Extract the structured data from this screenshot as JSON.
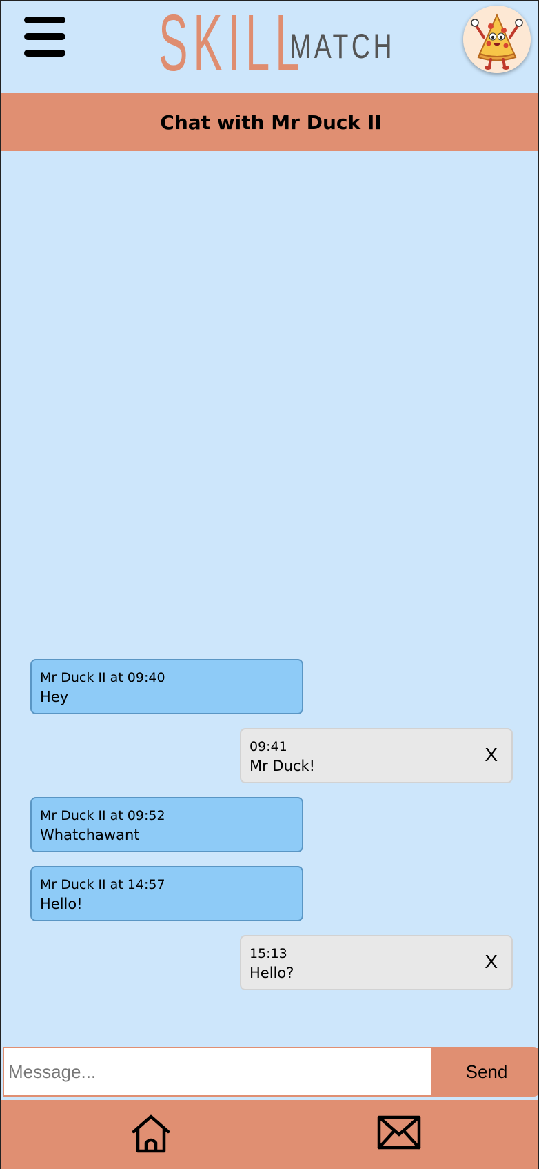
{
  "header": {
    "logo_primary": "SKILL",
    "logo_secondary": "MATCH",
    "menu_icon": "hamburger-menu-icon",
    "avatar_icon": "pizza-character-avatar"
  },
  "chat": {
    "title": "Chat with Mr Duck II",
    "messages": [
      {
        "direction": "incoming",
        "meta": "Mr Duck II at 09:40",
        "text": "Hey"
      },
      {
        "direction": "outgoing",
        "meta": "09:41",
        "text": "Mr Duck!",
        "delete_label": "X"
      },
      {
        "direction": "incoming",
        "meta": "Mr Duck II at 09:52",
        "text": "Whatchawant"
      },
      {
        "direction": "incoming",
        "meta": "Mr Duck II at 14:57",
        "text": "Hello!"
      },
      {
        "direction": "outgoing",
        "meta": "15:13",
        "text": "Hello?",
        "delete_label": "X"
      }
    ]
  },
  "composer": {
    "placeholder": "Message...",
    "value": "",
    "send_label": "Send"
  },
  "bottom_nav": {
    "home_icon": "home-icon",
    "messages_icon": "mail-icon"
  },
  "colors": {
    "background": "#cde6fb",
    "accent": "#e08f72",
    "incoming_bubble": "#8ecbf7",
    "outgoing_bubble": "#e8e8e8"
  }
}
